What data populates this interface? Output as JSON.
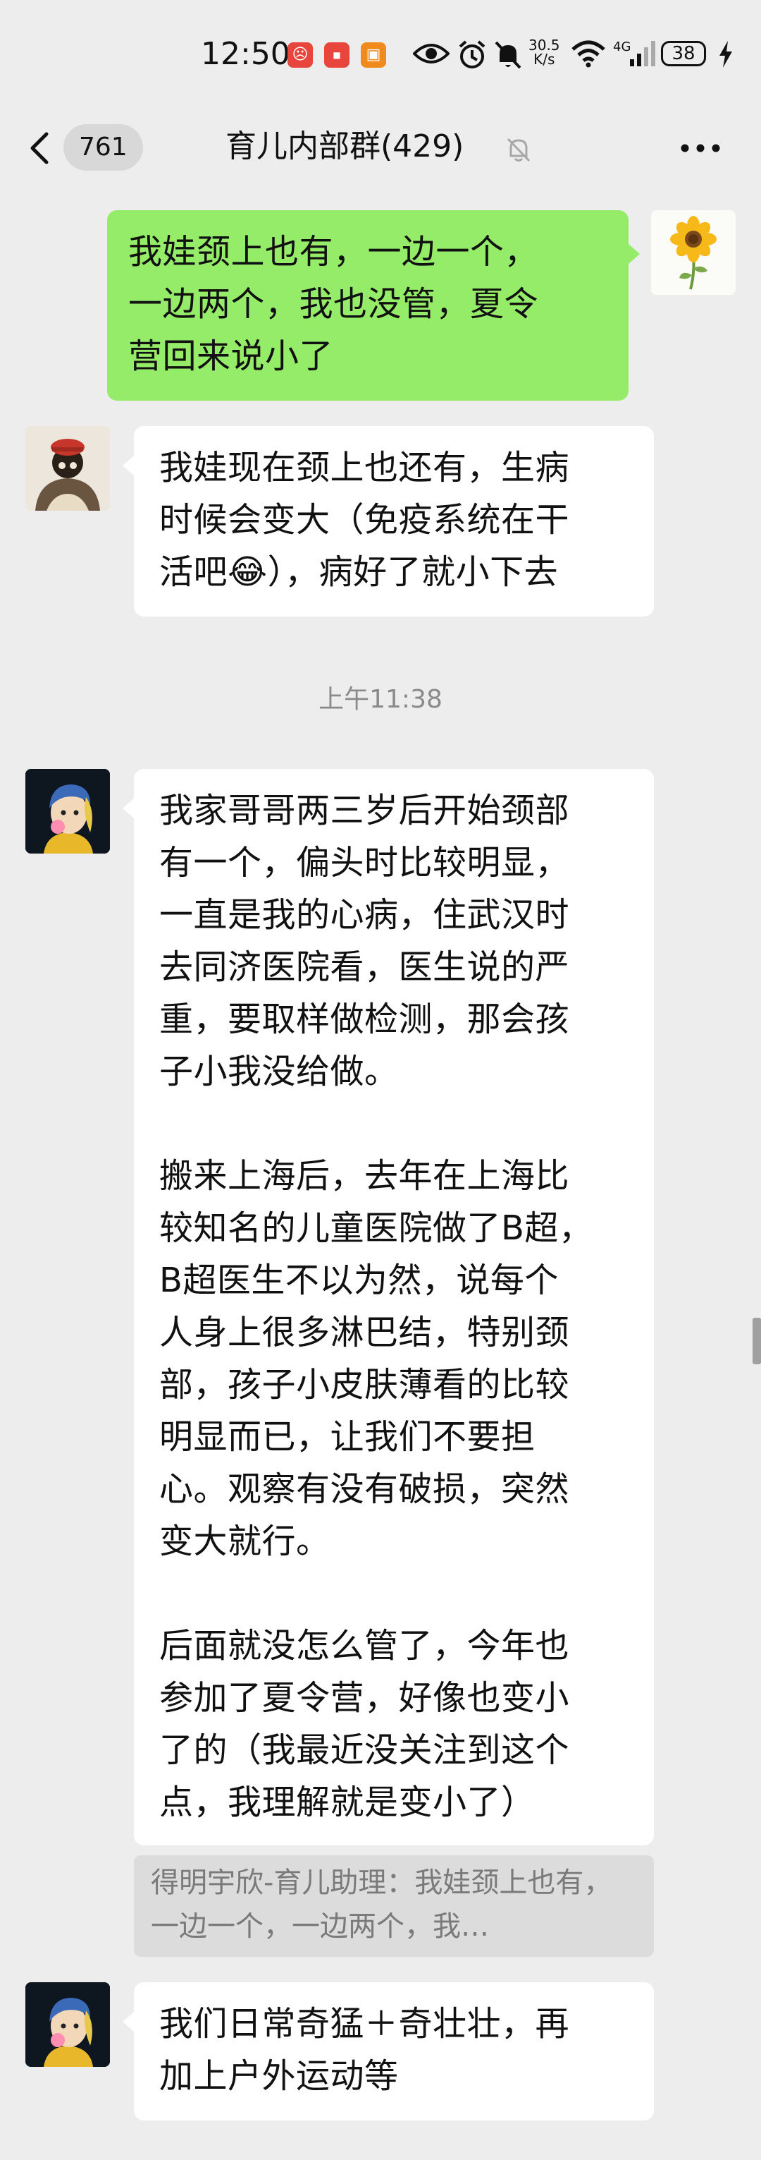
{
  "status_bar": {
    "time": "12:50",
    "network_speed_value": "30.5",
    "network_speed_unit": "K/s",
    "network_type": "4G",
    "battery": "38"
  },
  "header": {
    "unread_count": "761",
    "title": "育儿内部群(429)"
  },
  "messages": [
    {
      "sender": "me",
      "text": "我娃颈上也有，一边一个，\n一边两个，我也没管，夏令\n营回来说小了"
    },
    {
      "sender": "other",
      "text": "我娃现在颈上也还有，生病\n时候会变大（免疫系统在干\n活吧😂），病好了就小下去"
    },
    {
      "sender": "other",
      "text": "我家哥哥两三岁后开始颈部\n有一个，偏头时比较明显，\n一直是我的心病，住武汉时\n去同济医院看，医生说的严\n重，要取样做检测，那会孩\n子小我没给做。\n\n搬来上海后，去年在上海比\n较知名的儿童医院做了B超，\nB超医生不以为然，说每个\n人身上很多淋巴结，特别颈\n部，孩子小皮肤薄看的比较\n明显而已，让我们不要担\n心。观察有没有破损，突然\n变大就行。\n\n后面就没怎么管了，今年也\n参加了夏令营，好像也变小\n了的（我最近没关注到这个\n点，我理解就是变小了）"
    },
    {
      "sender": "other",
      "text": "我们日常奇猛＋奇壮壮，再\n加上户外运动等"
    }
  ],
  "timestamp": "上午11:38",
  "quote": {
    "text": "得明宇欣-育儿助理：我娃颈上也有，一边一个，一边两个，我…"
  }
}
